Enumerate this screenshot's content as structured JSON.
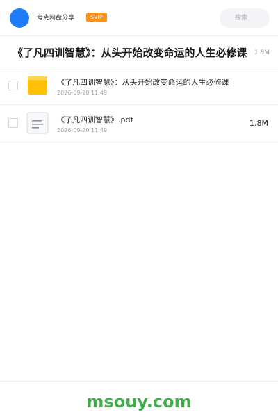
{
  "header": {
    "app_name": "夸克网盘分享",
    "badge": "SVIP",
    "search_placeholder": "搜索",
    "avatar_color": "#1f7cf7",
    "badge_color": "#f7921e"
  },
  "folder": {
    "title": "《了凡四训智慧》：从头开始改变命运的人生必修课",
    "size": "1.8M"
  },
  "files": [
    {
      "type": "folder-icon",
      "name": "《了凡四训智慧》：从头开始改变命运的人生必修课",
      "date": "2026-09-20 11:49",
      "size": ""
    },
    {
      "type": "document-icon",
      "name": "《了凡四训智慧》.pdf",
      "date": "2026-09-20 11:49",
      "size": "1.8M"
    }
  ],
  "footer": {
    "watermark": "msouy.com",
    "watermark_color": "#3fae49"
  }
}
